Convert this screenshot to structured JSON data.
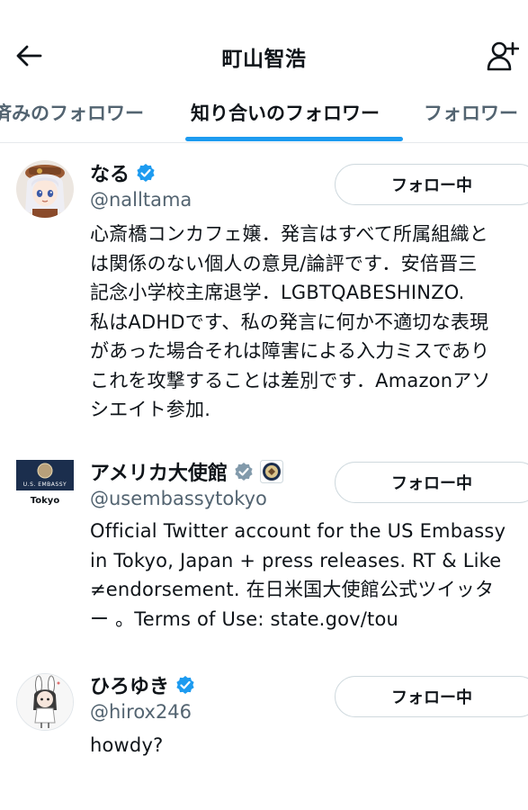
{
  "header": {
    "title": "町山智浩"
  },
  "tabs": [
    {
      "label": "済みのフォロワー"
    },
    {
      "label": "知り合いのフォロワー"
    },
    {
      "label": "フォロワー"
    }
  ],
  "users": [
    {
      "name": "なる",
      "handle": "@nalltama",
      "verified": "blue",
      "bio_lines": [
        "心斎橋コンカフェ嬢．発言はすべて所属組織と",
        "は関係のない個人の意見/論評です．安倍晋三",
        "記念小学校主席退学．LGBTQABESHINZO.",
        "私はADHDです、私の発言に何か不適切な表現",
        "があった場合それは障害による入力ミスであり",
        "これを攻撃することは差別です．Amazonアソ",
        "シエイト参加."
      ],
      "follow_label": "フォロー中"
    },
    {
      "name": "アメリカ大使館",
      "handle": "@usembassytokyo",
      "verified": "gray",
      "affiliate": "us-seal",
      "avatar_text_1": "U.S. EMBASSY",
      "avatar_text_2": "Tokyo",
      "bio_lines": [
        "Official Twitter account for the US Embassy",
        "in Tokyo, Japan + press releases. RT & Like",
        "≠endorsement. 在日米国大使館公式ツイッタ",
        "ー 。Terms of Use: state.gov/tou"
      ],
      "follow_label": "フォロー中"
    },
    {
      "name": "ひろゆき",
      "handle": "@hirox246",
      "verified": "blue",
      "bio_lines": [
        "howdy?"
      ],
      "follow_label": "フォロー中"
    }
  ],
  "colors": {
    "accent": "#1d9bf0",
    "secondary_text": "#536471",
    "verified_gray": "#829aab",
    "border": "#cfd9de"
  }
}
